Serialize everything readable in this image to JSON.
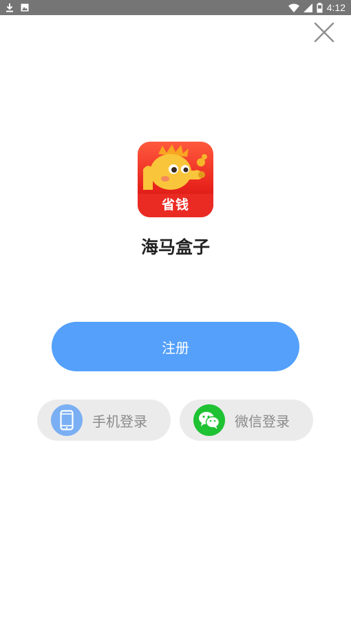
{
  "status_bar": {
    "time": "4:12",
    "left_icons": [
      "download-icon",
      "image-icon"
    ],
    "right_icons": [
      "wifi-icon",
      "signal-icon",
      "battery-icon"
    ]
  },
  "close": {
    "icon": "close-icon"
  },
  "logo": {
    "text": "省钱"
  },
  "app_name": "海马盒子",
  "register": {
    "label": "注册",
    "color": "#54a0fb"
  },
  "login_options": [
    {
      "label": "手机登录",
      "icon": "phone-icon",
      "color": "#7aaff3"
    },
    {
      "label": "微信登录",
      "icon": "wechat-icon",
      "color": "#1fc232"
    }
  ]
}
